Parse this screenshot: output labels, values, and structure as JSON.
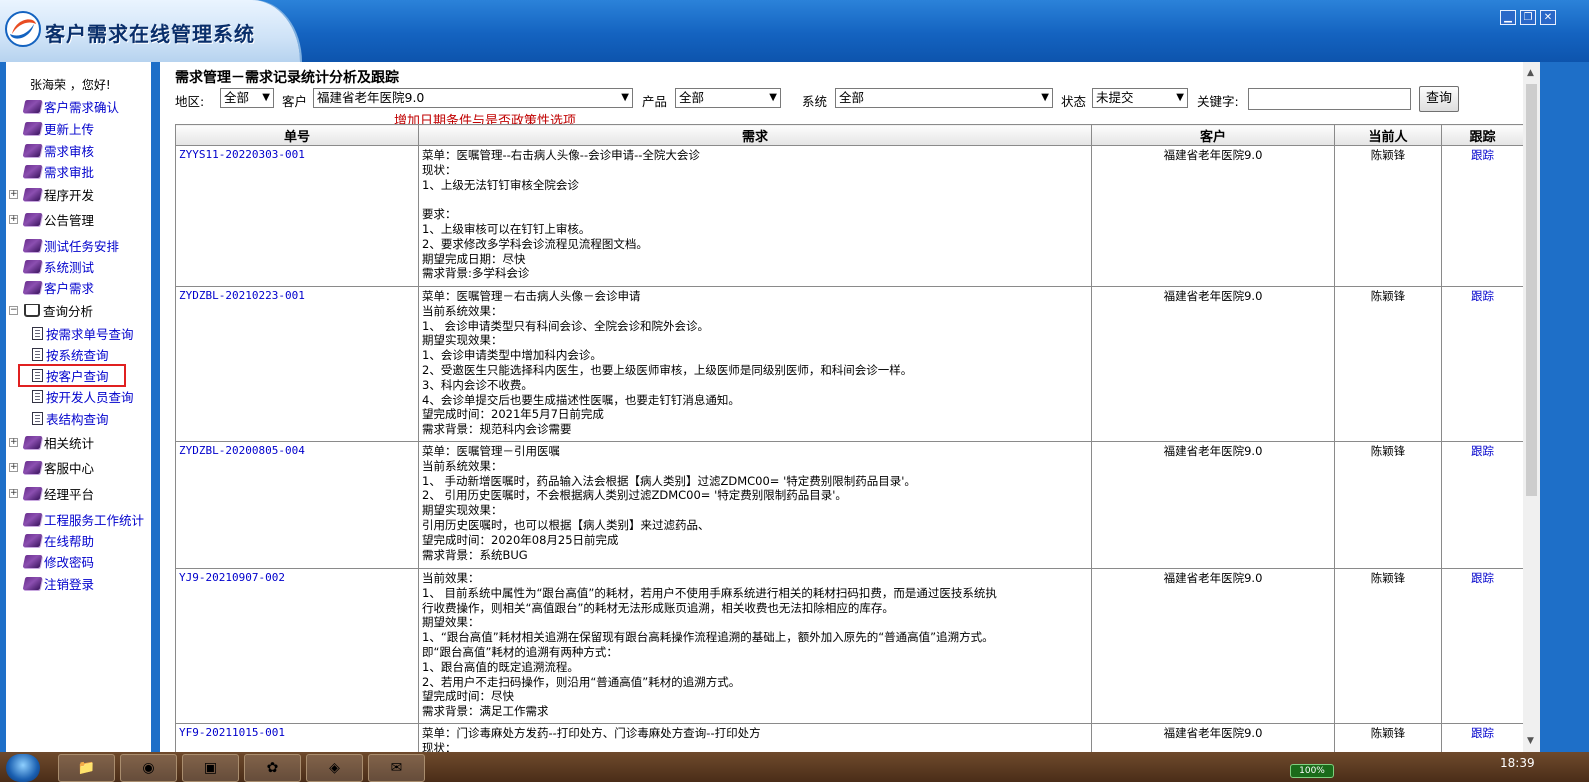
{
  "app": {
    "title": "客户需求在线管理系统",
    "window_buttons": {
      "minimize": "▁",
      "restore": "❐",
      "close": "✕"
    }
  },
  "sidebar": {
    "greeting": "张海荣 ，您好!",
    "items": [
      {
        "label": "客户需求确认",
        "icon": "book-icon"
      },
      {
        "label": "更新上传",
        "icon": "book-icon"
      },
      {
        "label": "需求审核",
        "icon": "book-icon"
      },
      {
        "label": "需求审批",
        "icon": "book-icon"
      },
      {
        "label": "程序开发",
        "icon": "book-icon",
        "expander": "+"
      },
      {
        "label": "公告管理",
        "icon": "book-icon",
        "expander": "+"
      },
      {
        "label": "测试任务安排",
        "icon": "book-icon"
      },
      {
        "label": "系统测试",
        "icon": "book-icon"
      },
      {
        "label": "客户需求",
        "icon": "book-icon"
      },
      {
        "label": "查询分析",
        "icon": "open-book-icon",
        "expander": "−"
      },
      {
        "label": "按需求单号查询",
        "icon": "document-icon"
      },
      {
        "label": "按系统查询",
        "icon": "document-icon"
      },
      {
        "label": "按客户查询",
        "icon": "document-icon",
        "highlighted": true
      },
      {
        "label": "按开发人员查询",
        "icon": "document-icon"
      },
      {
        "label": "表结构查询",
        "icon": "document-icon"
      },
      {
        "label": "相关统计",
        "icon": "book-icon",
        "expander": "+"
      },
      {
        "label": "客服中心",
        "icon": "book-icon",
        "expander": "+"
      },
      {
        "label": "经理平台",
        "icon": "book-icon",
        "expander": "+"
      },
      {
        "label": "工程服务工作统计",
        "icon": "book-icon"
      },
      {
        "label": "在线帮助",
        "icon": "book-icon"
      },
      {
        "label": "修改密码",
        "icon": "book-icon"
      },
      {
        "label": "注销登录",
        "icon": "book-icon"
      }
    ]
  },
  "main": {
    "page_title": "需求管理－需求记录统计分析及跟踪",
    "filters": {
      "region_label": "地区:",
      "region_value": "全部",
      "customer_label": "客户",
      "customer_value": "福建省老年医院9.0",
      "product_label": "产品",
      "product_value": "全部",
      "system_label": "系统",
      "system_value": "全部",
      "status_label": "状态",
      "status_value": "未提交",
      "keyword_label": "关键字:",
      "keyword_value": "",
      "search_button": "查询"
    },
    "notice": "增加日期条件与是否政策性选项",
    "table": {
      "headers": [
        "单号",
        "需求",
        "客户",
        "当前人",
        "跟踪"
      ],
      "rows": [
        {
          "id": "ZYYS11-20220303-001",
          "requirement": [
            "菜单：医嘱管理--右击病人头像--会诊申请--全院大会诊",
            "现状：",
            "1、上级无法钉钉审核全院会诊",
            "",
            "要求：",
            "1、上级审核可以在钉钉上审核。",
            "2、要求修改多学科会诊流程见流程图文档。",
            "期望完成日期：尽快",
            "需求背景:多学科会诊"
          ],
          "customer": "福建省老年医院9.0",
          "owner": "陈颖锋",
          "track": "跟踪"
        },
        {
          "id": "ZYDZBL-20210223-001",
          "requirement": [
            "菜单：医嘱管理－右击病人头像－会诊申请",
            "当前系统效果：",
            "1、 会诊申请类型只有科间会诊、全院会诊和院外会诊。",
            "期望实现效果：",
            "1、会诊申请类型中增加科内会诊。",
            "2、受邀医生只能选择科内医生，也要上级医师审核，上级医师是同级别医师，和科间会诊一样。",
            "3、科内会诊不收费。",
            "4、会诊单提交后也要生成描述性医嘱，也要走钉钉消息通知。",
            "望完成时间：2021年5月7日前完成",
            "需求背景：规范科内会诊需要"
          ],
          "customer": "福建省老年医院9.0",
          "owner": "陈颖锋",
          "track": "跟踪"
        },
        {
          "id": "ZYDZBL-20200805-004",
          "requirement": [
            "菜单：医嘱管理－引用医嘱",
            "当前系统效果：",
            "1、 手动新增医嘱时，药品输入法会根据【病人类别】过滤ZDMC00= '特定费别限制药品目录'。",
            "2、 引用历史医嘱时，不会根据病人类别过滤ZDMC00= '特定费别限制药品目录'。",
            "期望实现效果：",
            "引用历史医嘱时，也可以根据【病人类别】来过滤药品、",
            "望完成时间：2020年08月25日前完成",
            "需求背景：系统BUG"
          ],
          "customer": "福建省老年医院9.0",
          "owner": "陈颖锋",
          "track": "跟踪"
        },
        {
          "id": "YJ9-20210907-002",
          "requirement": [
            "当前效果：",
            "1、 目前系统中属性为“跟台高值”的耗材，若用户不使用手麻系统进行相关的耗材扫码扣费，而是通过医技系统执",
            "行收费操作，则相关“高值跟台”的耗材无法形成账页追溯，相关收费也无法扣除相应的库存。",
            "期望效果：",
            "1、“跟台高值”耗材相关追溯在保留现有跟台高耗操作流程追溯的基础上，额外加入原先的“普通高值”追溯方式。",
            "即“跟台高值”耗材的追溯有两种方式：",
            "1、跟台高值的既定追溯流程。",
            "2、若用户不走扫码操作，则沿用“普通高值”耗材的追溯方式。",
            "望完成时间：尽快",
            "需求背景：满足工作需求"
          ],
          "customer": "福建省老年医院9.0",
          "owner": "陈颖锋",
          "track": "跟踪"
        },
        {
          "id": "YF9-20211015-001",
          "requirement": [
            "菜单：门诊毒麻处方发药--打印处方、门诊毒麻处方查询--打印处方",
            "现状："
          ],
          "customer": "福建省老年医院9.0",
          "owner": "陈颖锋",
          "track": "跟踪"
        }
      ]
    }
  },
  "taskbar": {
    "clock": "18:39",
    "battery": "100%"
  },
  "colors": {
    "header_blue": "#1463c0",
    "link_blue": "#0000cc",
    "notice_red": "#c00000",
    "highlight_red": "#e02020"
  }
}
